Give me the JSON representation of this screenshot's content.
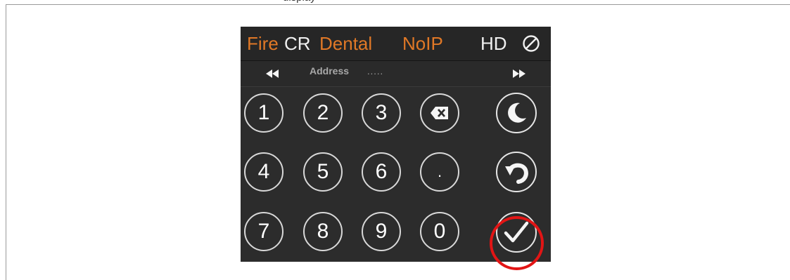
{
  "caption_fragment": "display",
  "title": {
    "brand_part1": "Fire",
    "brand_part2": "CR",
    "product": "Dental",
    "network_mode": "NoIP",
    "resolution": "HD",
    "cancel_icon": "cancel-icon"
  },
  "address_bar": {
    "label": "Address",
    "value": ".....",
    "prev_icon": "rewind-icon",
    "next_icon": "fast-forward-icon"
  },
  "keypad": {
    "keys": [
      "1",
      "2",
      "3",
      "4",
      "5",
      "6",
      "7",
      "8",
      "9",
      "0",
      "."
    ],
    "backspace_icon": "backspace-icon",
    "sleep_icon": "moon-icon",
    "undo_icon": "undo-icon",
    "confirm_icon": "checkmark-icon"
  },
  "colors": {
    "accent_orange": "#e07826",
    "highlight_red": "#e21515",
    "panel_bg": "#2c2c2c"
  }
}
